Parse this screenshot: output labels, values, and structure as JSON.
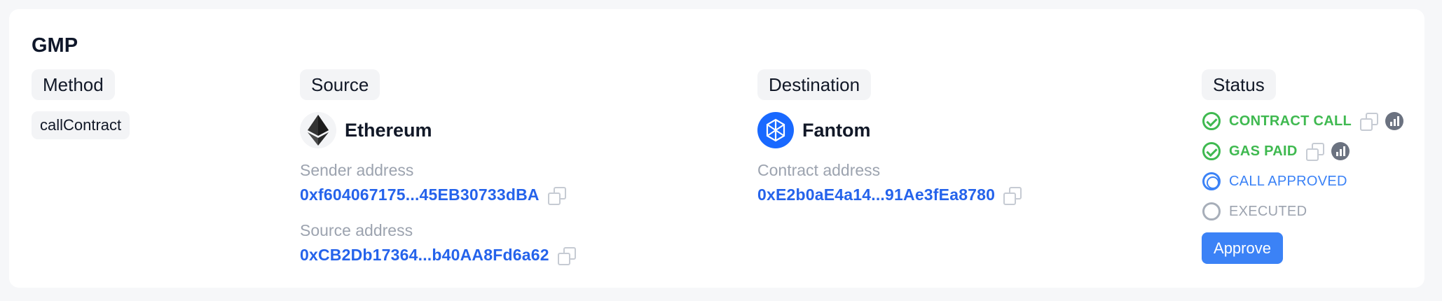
{
  "section": {
    "title": "GMP"
  },
  "columns": {
    "method": "Method",
    "source": "Source",
    "destination": "Destination",
    "status": "Status"
  },
  "method": {
    "value": "callContract"
  },
  "source": {
    "chain": "Ethereum",
    "sender_label": "Sender address",
    "sender_address": "0xf604067175...45EB30733dBA",
    "source_label": "Source address",
    "source_address": "0xCB2Db17364...b40AA8Fd6a62"
  },
  "destination": {
    "chain": "Fantom",
    "contract_label": "Contract address",
    "contract_address": "0xE2b0aE4a14...91Ae3fEa8780"
  },
  "status": {
    "steps": [
      {
        "label": "CONTRACT CALL",
        "state": "done"
      },
      {
        "label": "GAS PAID",
        "state": "done"
      },
      {
        "label": "CALL APPROVED",
        "state": "pending"
      },
      {
        "label": "EXECUTED",
        "state": "not-started"
      }
    ],
    "approve_label": "Approve"
  },
  "colors": {
    "success": "#3fb950",
    "link": "#2563eb",
    "primary": "#3b82f6",
    "ethereum_logo_bg": "#f3f4f6",
    "fantom_logo_bg": "#1969ff"
  }
}
